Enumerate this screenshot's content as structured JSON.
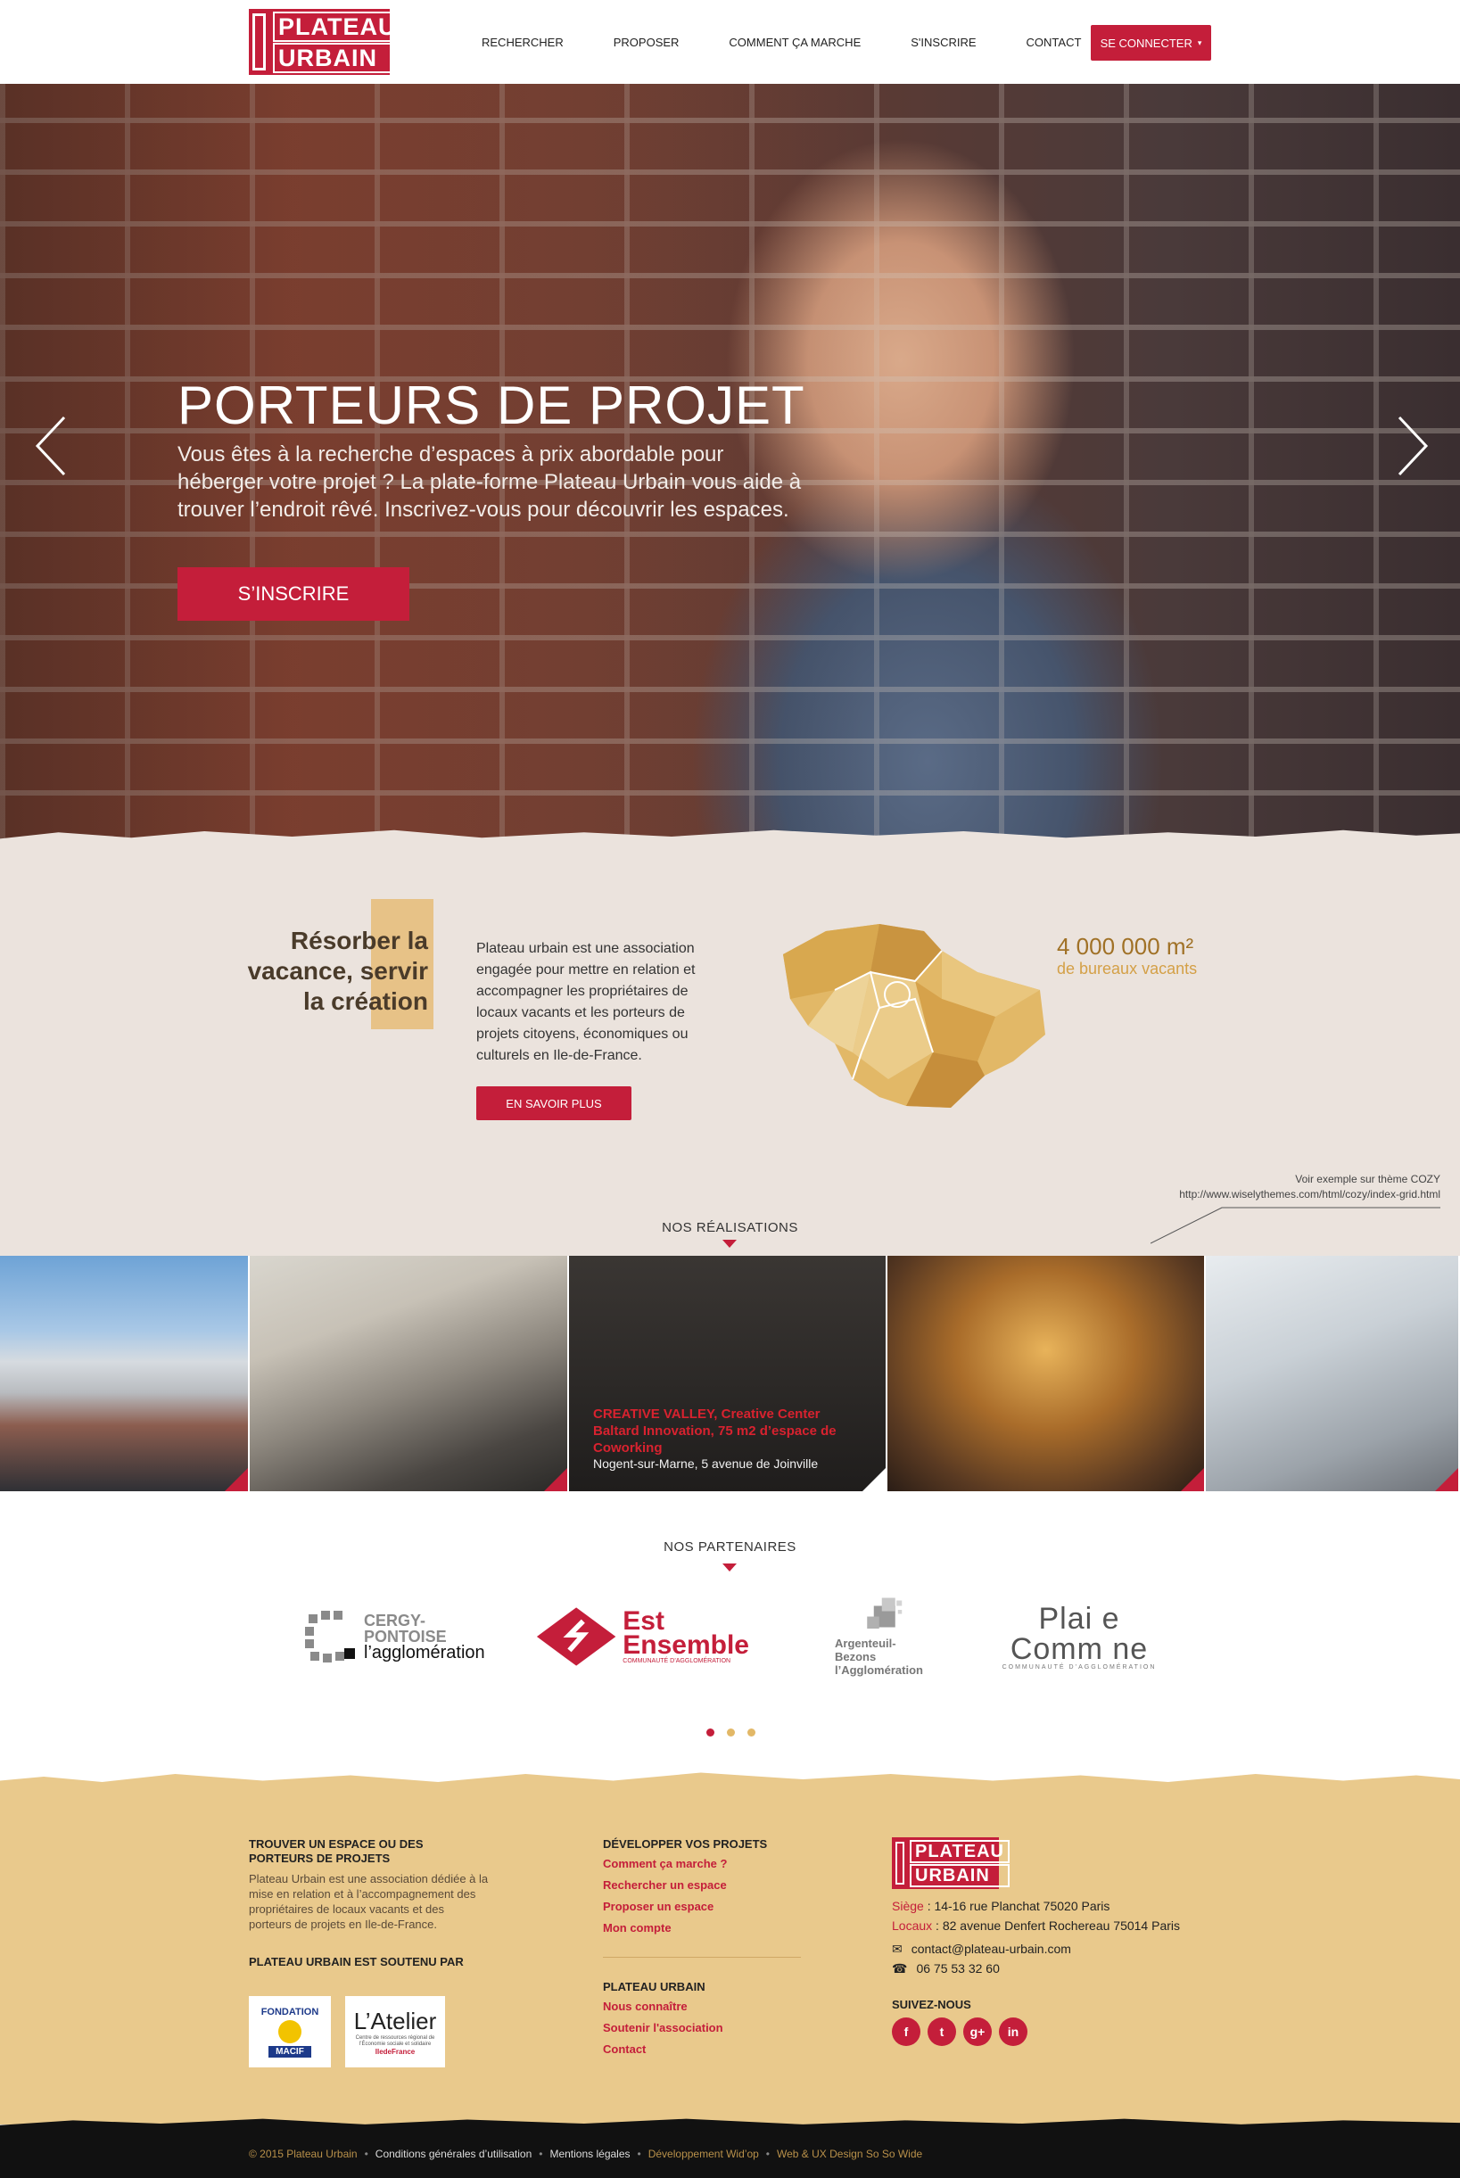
{
  "colors": {
    "accent": "#c41e3a",
    "gold": "#a07126",
    "sand": "#e9c98c",
    "stone": "#ebe3dd"
  },
  "brand": {
    "line1": "PLATEAU",
    "line2": "URBAIN"
  },
  "nav": {
    "items": [
      "RECHERCHER",
      "PROPOSER",
      "COMMENT ÇA MARCHE",
      "S'INSCRIRE",
      "CONTACT"
    ],
    "login": "SE CONNECTER"
  },
  "hero": {
    "title": "PORTEURS DE PROJET",
    "text": "Vous êtes à la recherche d’espaces à prix abordable pour héberger votre projet ? La plate-forme Plateau Urbain vous aide à trouver l’endroit rêvé. Inscrivez-vous pour découvrir les espaces.",
    "button": "S’INSCRIRE"
  },
  "about": {
    "title": "Résorber la vacance, servir la création",
    "text": "Plateau urbain est une association engagée pour mettre en relation et accompagner les propriétaires de locaux vacants et les porteurs de projets citoyens, économiques ou culturels en Ile-de-France.",
    "button": "EN SAVOIR PLUS",
    "stat_value": "4 000 000 m²",
    "stat_label": "de bureaux vacants",
    "note_line1": "Voir exemple sur thème COZY",
    "note_line2": "http://www.wiselythemes.com/html/cozy/index-grid.html"
  },
  "realisations": {
    "title": "NOS RÉALISATIONS",
    "featured_title": "CREATIVE VALLEY, Creative Center Baltard Innovation, 75 m2 d’espace de Coworking",
    "featured_address": "Nogent-sur-Marne, 5 avenue de Joinville"
  },
  "partners": {
    "title": "NOS PARTENAIRES",
    "cergy_1": "CERGY-",
    "cergy_2": "PONTOISE",
    "cergy_3": "l’agglomération",
    "est_1": "Est",
    "est_2": "Ensemble",
    "est_3": "COMMUNAUTÉ D’AGGLOMÉRATION",
    "argenteuil_1": "Argenteuil-Bezons",
    "argenteuil_2": "l’Agglomération",
    "plaine_1": "Plai e",
    "plaine_2": "Comm ne",
    "plaine_3": "COMMUNAUTÉ D’AGGLOMÉRATION"
  },
  "footer": {
    "col1_title": "TROUVER UN ESPACE OU DES PORTEURS DE PROJETS",
    "col1_text": "Plateau Urbain est une association dédiée à la mise en relation et à l’accompagnement des propriétaires de locaux vacants et des porteurs de projets en Ile-de-France.",
    "support_title": "PLATEAU URBAIN EST SOUTENU PAR",
    "fondation_1": "FONDATION",
    "fondation_2": "MACIF",
    "atelier_1": "L’Atelier",
    "atelier_2": "Centre de ressources régional de l’Économie sociale et solidaire",
    "atelier_3": "IledeFrance",
    "col2_title": "DÉVELOPPER VOS PROJETS",
    "col2_links": [
      "Comment ça marche ?",
      "Rechercher un espace",
      "Proposer un espace",
      "Mon compte"
    ],
    "col3_title": "PLATEAU URBAIN",
    "col3_links": [
      "Nous connaître",
      "Soutenir l'association",
      "Contact"
    ],
    "siege_label": "Siège",
    "siege_value": " : 14-16 rue Planchat 75020 Paris",
    "locaux_label": "Locaux",
    "locaux_value": " : 82 avenue Denfert Rochereau 75014 Paris",
    "email": "contact@plateau-urbain.com",
    "phone": "06 75 53 32 60",
    "follow": "SUIVEZ-NOUS",
    "social": [
      "f",
      "t",
      "g+",
      "in"
    ]
  },
  "bottom": {
    "copyright": "© 2015 Plateau Urbain",
    "cgu": "Conditions générales d’utilisation",
    "mentions": "Mentions légales",
    "dev": "Développement Wid’op",
    "design": "Web & UX Design So So Wide"
  },
  "icons": {
    "prev": "chevron-left-icon",
    "next": "chevron-right-icon",
    "login_caret": "chevron-down-icon",
    "email": "envelope-icon",
    "phone": "phone-icon"
  }
}
